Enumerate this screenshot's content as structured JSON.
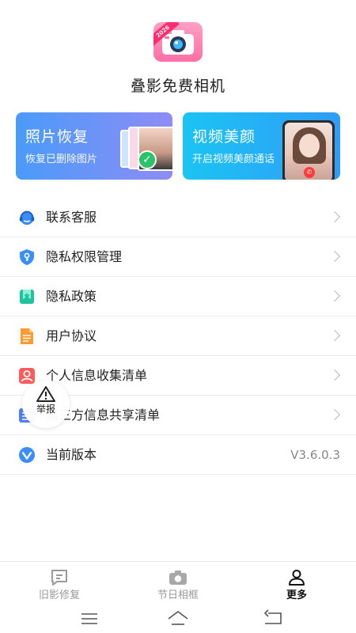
{
  "header": {
    "app_title": "叠影免费相机",
    "logo_badge": "2026"
  },
  "cards": [
    {
      "title": "照片恢复",
      "subtitle": "恢复已删除图片"
    },
    {
      "title": "视频美颜",
      "subtitle": "开启视频美颜通话"
    }
  ],
  "menu": {
    "items": [
      {
        "label": "联系客服",
        "icon": "customer-service-icon"
      },
      {
        "label": "隐私权限管理",
        "icon": "privacy-shield-icon"
      },
      {
        "label": "隐私政策",
        "icon": "policy-bookmark-icon"
      },
      {
        "label": "用户协议",
        "icon": "document-icon"
      },
      {
        "label": "个人信息收集清单",
        "icon": "person-icon"
      },
      {
        "label": "第三方信息共享清单",
        "icon": "list-icon"
      },
      {
        "label": "当前版本",
        "icon": "version-icon",
        "value": "V3.6.0.3"
      }
    ]
  },
  "report": {
    "label": "举报"
  },
  "bottom_nav": {
    "items": [
      {
        "label": "旧影修复",
        "icon": "chat-icon",
        "active": false
      },
      {
        "label": "节日相框",
        "icon": "camera-icon",
        "active": false
      },
      {
        "label": "更多",
        "icon": "user-icon",
        "active": true
      }
    ]
  },
  "colors": {
    "card_recover": "#4a9bf8",
    "card_beauty": "#1bc4f4",
    "icon_blue": "#3a8ef6",
    "icon_teal": "#1fc3a0",
    "icon_orange": "#ff8a2b",
    "icon_red": "#ff5a5a"
  }
}
